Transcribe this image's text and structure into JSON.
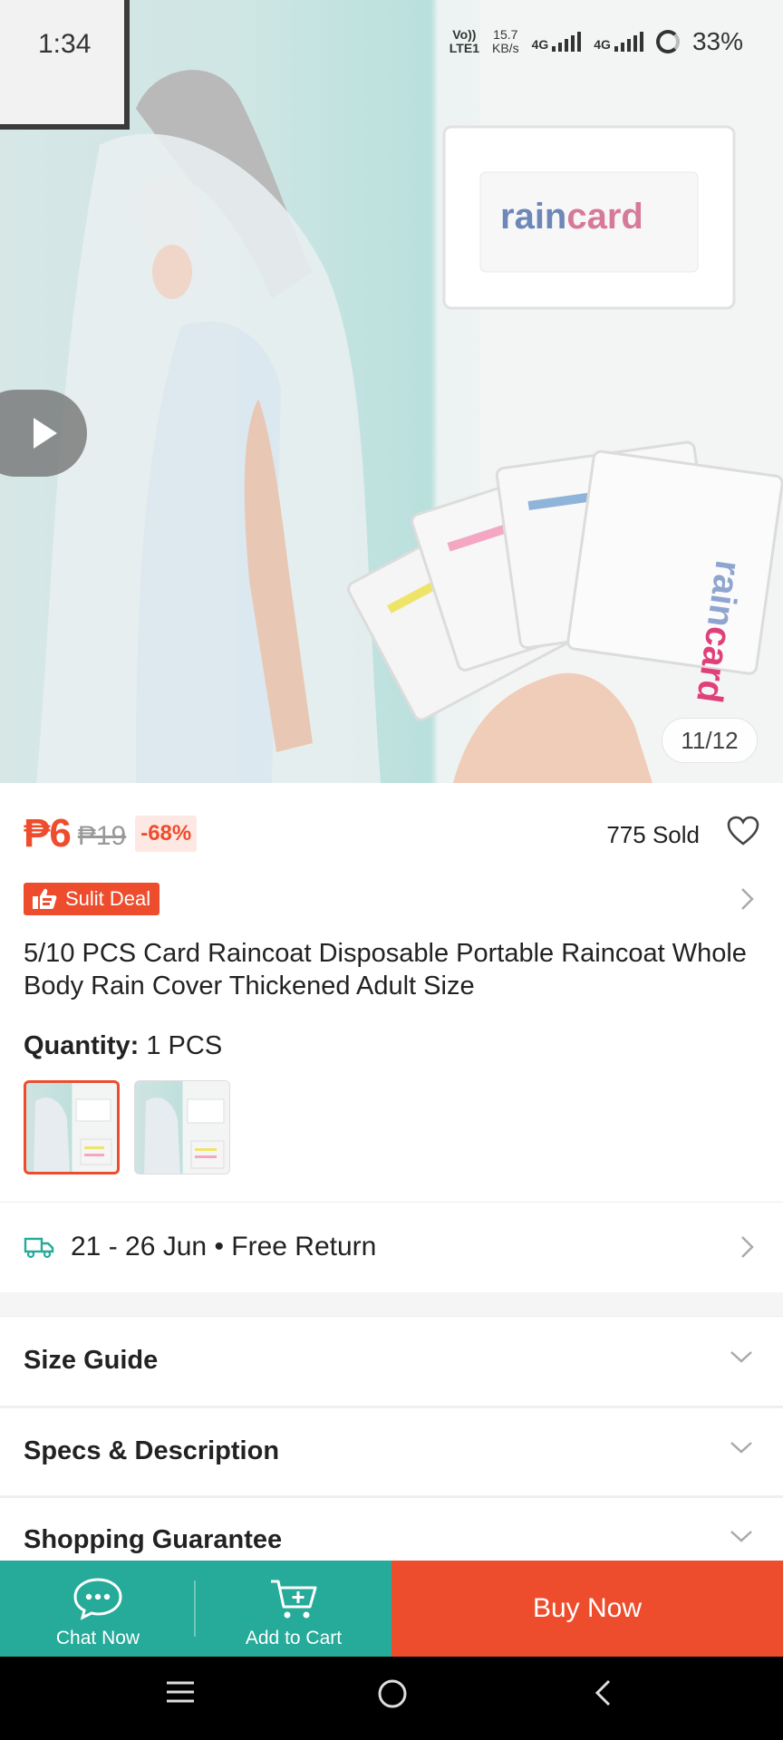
{
  "status_bar": {
    "time": "1:34",
    "volte_top": "Vo))",
    "volte_bottom": "LTE1",
    "speed_value": "15.7",
    "speed_unit": "KB/s",
    "network_1": "4G",
    "network_2": "4G",
    "battery": "33%"
  },
  "hero": {
    "image_counter": "11/12",
    "product_brand_text": "raincard"
  },
  "price": {
    "current": "₱6",
    "original": "₱19",
    "discount": "-68%",
    "sold": "775 Sold"
  },
  "deal_badge": {
    "label": "Sulit Deal"
  },
  "product": {
    "title": "5/10 PCS Card Raincoat Disposable Portable Raincoat Whole Body Rain Cover Thickened Adult Size"
  },
  "variation": {
    "label": "Quantity:",
    "value": "1 PCS"
  },
  "delivery": {
    "text": "21 - 26 Jun • Free Return"
  },
  "sections": [
    {
      "label": "Size Guide"
    },
    {
      "label": "Specs & Description"
    },
    {
      "label": "Shopping Guarantee"
    }
  ],
  "bottom_bar": {
    "chat_label": "Chat Now",
    "cart_label": "Add to Cart",
    "buy_label": "Buy Now"
  },
  "colors": {
    "accent": "#ee4d2d",
    "teal": "#26aa99"
  }
}
